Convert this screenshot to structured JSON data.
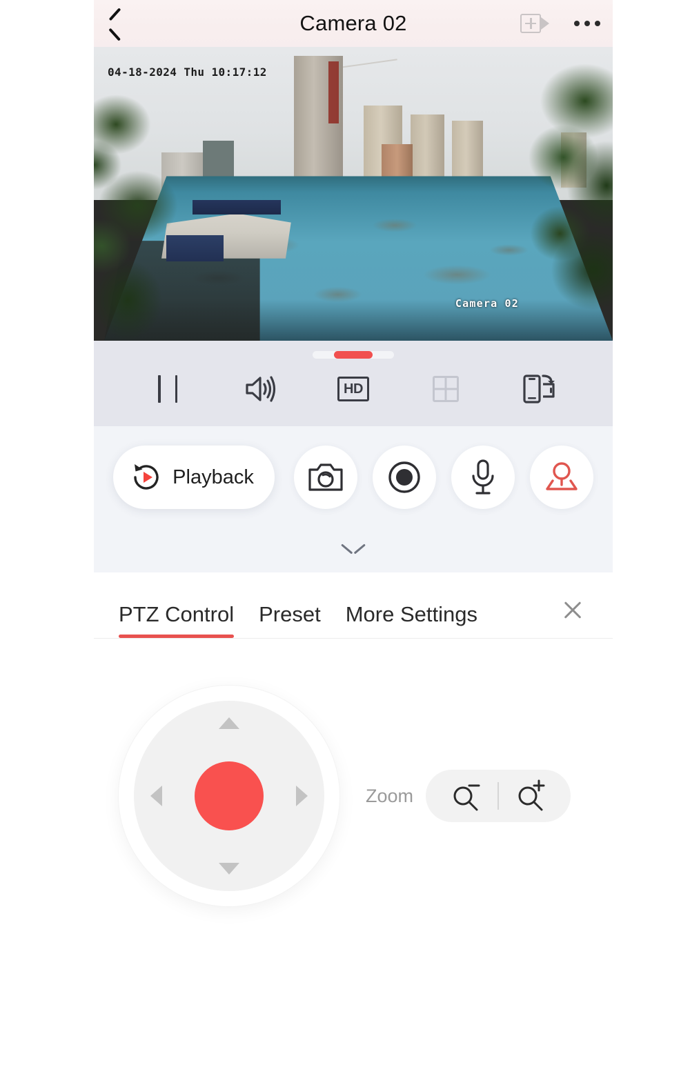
{
  "header": {
    "title": "Camera 02",
    "back_icon": "back-chevron-icon",
    "add_camera_icon": "add-camera-icon",
    "more_icon": "more-options-icon"
  },
  "video": {
    "timestamp": "04-18-2024 Thu 10:17:12",
    "watermark": "Camera 02",
    "scene": "rooftop-city-view"
  },
  "stream_toolbar": {
    "progress_percent": 47,
    "accent_color": "#f1504f",
    "track_color": "#f3f4f7",
    "background": "#e4e5ec",
    "items": [
      {
        "name": "pause-button",
        "icon": "pause-icon",
        "state": "enabled"
      },
      {
        "name": "volume-button",
        "icon": "speaker-icon",
        "state": "enabled"
      },
      {
        "name": "quality-button",
        "icon": "hd-icon",
        "label": "HD",
        "state": "enabled"
      },
      {
        "name": "split-screen-button",
        "icon": "grid-four-icon",
        "state": "disabled"
      },
      {
        "name": "rotate-screen-button",
        "icon": "rotate-screen-icon",
        "state": "enabled"
      }
    ]
  },
  "actions": {
    "playback_label": "Playback",
    "playback_icon": "playback-replay-icon",
    "snapshot_icon": "camera-icon",
    "record_icon": "record-circle-icon",
    "mic_icon": "microphone-icon",
    "ptz_icon": "ptz-person-icon",
    "ptz_active_color": "#e0564f",
    "collapse_icon": "chevron-down-icon"
  },
  "panel": {
    "tabs": [
      {
        "label": "PTZ Control",
        "active": true
      },
      {
        "label": "Preset",
        "active": false
      },
      {
        "label": "More Settings",
        "active": false
      }
    ],
    "close_icon": "close-icon",
    "active_underline_color": "#e8514f"
  },
  "ptz": {
    "joystick": {
      "knob_color": "#f9514f",
      "arrow_up": "arrow-up-icon",
      "arrow_down": "arrow-down-icon",
      "arrow_left": "arrow-left-icon",
      "arrow_right": "arrow-right-icon"
    },
    "zoom_label": "Zoom",
    "zoom_out_icon": "magnifier-minus-icon",
    "zoom_in_icon": "magnifier-plus-icon"
  }
}
